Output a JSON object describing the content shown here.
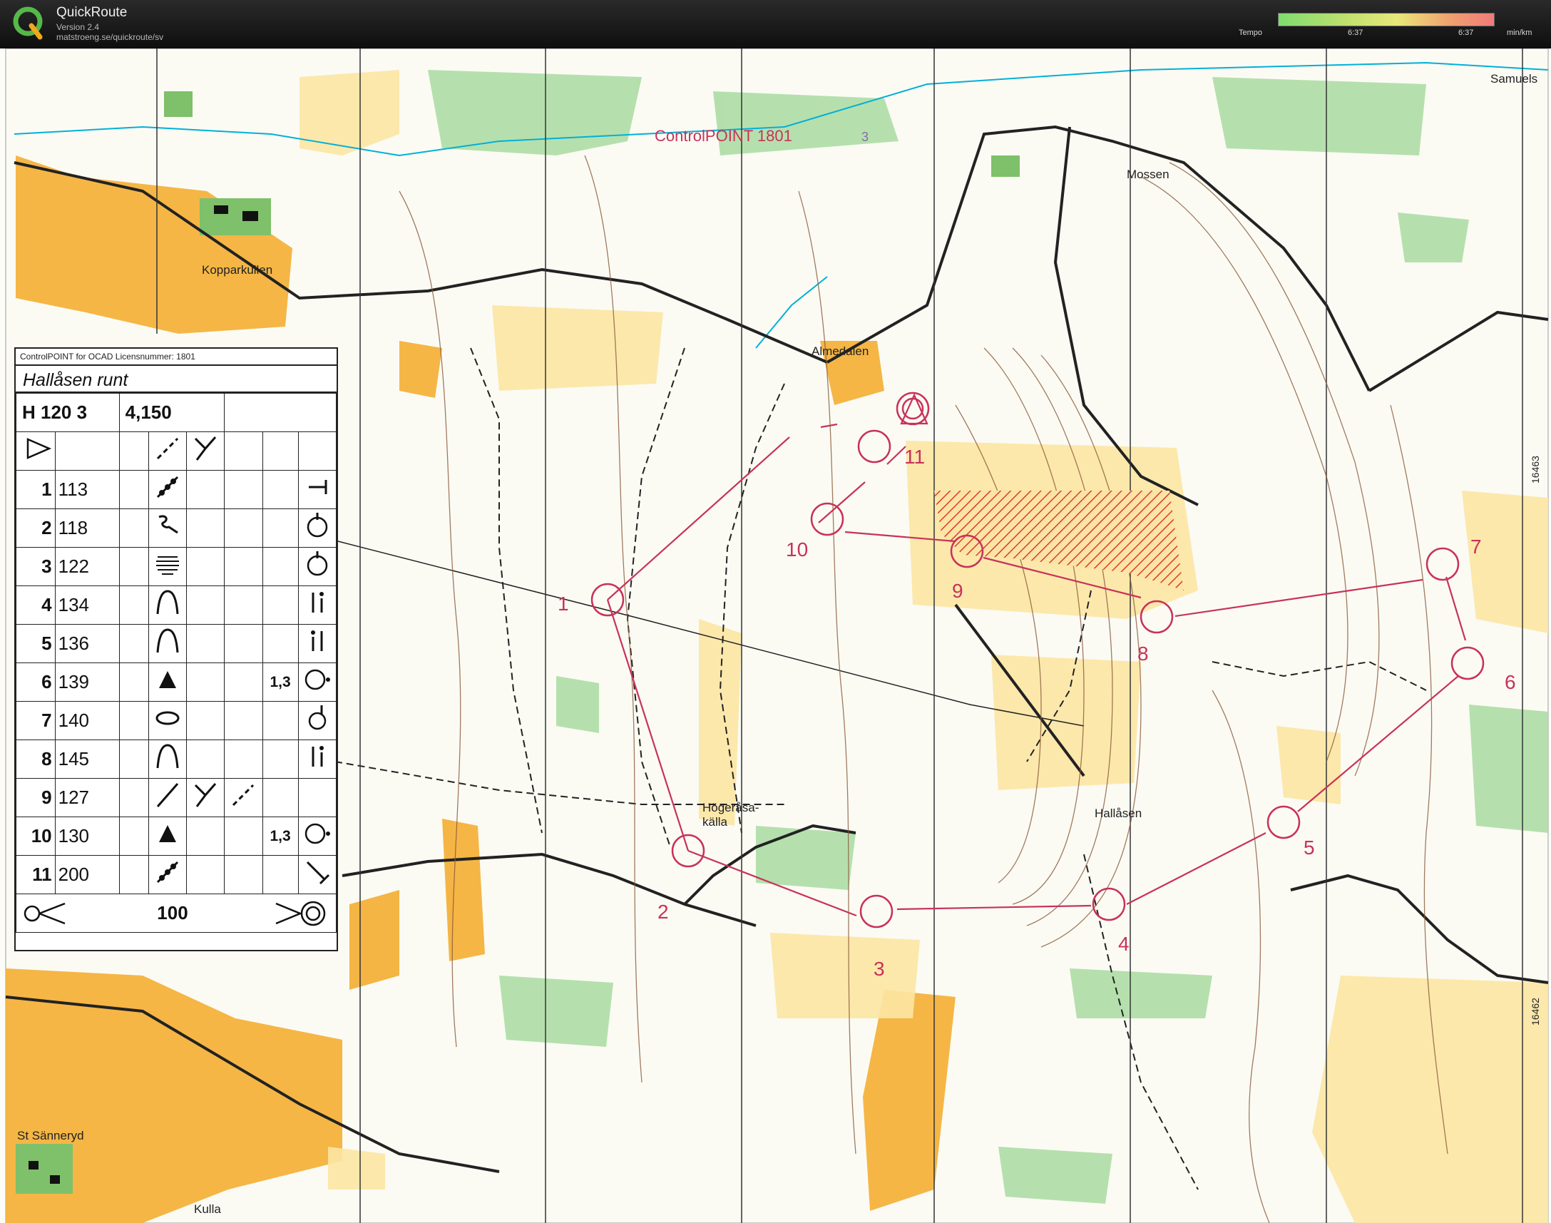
{
  "app": {
    "name": "QuickRoute",
    "version": "Version 2.4",
    "url": "matstroeng.se/quickroute/sv"
  },
  "tempo": {
    "label": "Tempo",
    "mid_value": "6:37",
    "max_value": "6:37",
    "unit": "min/km",
    "colors": [
      "#7fdc6f",
      "#e8e77a",
      "#f07a7a"
    ]
  },
  "map": {
    "overprint_title": "ControlPOINT 1801",
    "overprint_title_suffix": "3",
    "place_names": [
      "Kopparkullen",
      "Almedalen",
      "Mossen",
      "Samuels",
      "Högeråsa-",
      "källa",
      "Hallåsen",
      "St Sänneryd",
      "Kulla"
    ],
    "grid_labels": [
      "16463",
      "16462"
    ],
    "control_numbers": [
      "1",
      "2",
      "3",
      "4",
      "5",
      "6",
      "7",
      "8",
      "9",
      "10",
      "11"
    ],
    "colors": {
      "course": "#c8325a",
      "open_land": "#f4b23c",
      "rough_open": "#fce5a3",
      "green": "#a8dba0",
      "water": "#00b0d8",
      "contour": "#8a5a3a"
    }
  },
  "description": {
    "header": "ControlPOINT for OCAD Licensnummer: 1801",
    "course_name": "Hallåsen runt",
    "class": "H 120 3",
    "length": "4,150",
    "rows": [
      {
        "num": "1",
        "code": "113",
        "feature": "knoll-row-icon",
        "dim": "",
        "detail": "t-shape-icon"
      },
      {
        "num": "2",
        "code": "118",
        "feature": "hook-icon",
        "dim": "",
        "detail": "circle-top-icon"
      },
      {
        "num": "3",
        "code": "122",
        "feature": "stacked-lines-icon",
        "dim": "",
        "detail": "circle-top-icon"
      },
      {
        "num": "4",
        "code": "134",
        "feature": "hill-icon",
        "dim": "",
        "detail": "double-bar-icon"
      },
      {
        "num": "5",
        "code": "136",
        "feature": "hill-icon",
        "dim": "",
        "detail": "double-bar-icon"
      },
      {
        "num": "6",
        "code": "139",
        "feature": "triangle-icon",
        "dim": "1,3",
        "detail": "circle-dot-icon"
      },
      {
        "num": "7",
        "code": "140",
        "feature": "ellipse-icon",
        "dim": "",
        "detail": "circle-bottom-icon"
      },
      {
        "num": "8",
        "code": "145",
        "feature": "hill-icon",
        "dim": "",
        "detail": "double-bar-icon"
      },
      {
        "num": "9",
        "code": "127",
        "feature": "slash-icon",
        "dim": "",
        "detail": "dashed-slash-icon"
      },
      {
        "num": "10",
        "code": "130",
        "feature": "triangle-icon",
        "dim": "1,3",
        "detail": "circle-dot-icon"
      },
      {
        "num": "11",
        "code": "200",
        "feature": "knoll-row-icon",
        "dim": "",
        "detail": "backslash-t-icon"
      }
    ],
    "finish_distance": "100"
  }
}
